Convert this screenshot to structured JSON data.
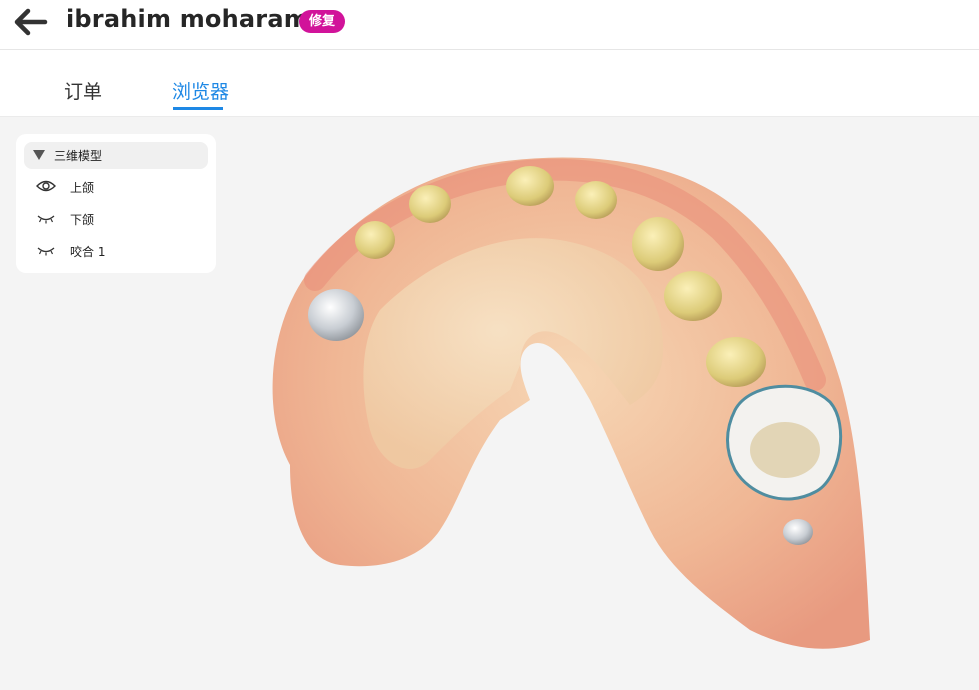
{
  "header": {
    "patient_name": "ibrahim moharam",
    "badge_label": "修复",
    "badge_color": "#d1139a",
    "back_icon": "arrow-left-icon"
  },
  "tabs": [
    {
      "label": "订单",
      "active": false
    },
    {
      "label": "浏览器",
      "active": true
    }
  ],
  "accent_color": "#1e88e5",
  "layers_panel": {
    "title": "三维模型",
    "items": [
      {
        "label": "上颌",
        "icon": "eye-open-icon",
        "visible": true
      },
      {
        "label": "下颌",
        "icon": "eye-closed-icon",
        "visible": false
      },
      {
        "label": "咬合 1",
        "icon": "eye-closed-icon",
        "visible": false
      }
    ]
  }
}
